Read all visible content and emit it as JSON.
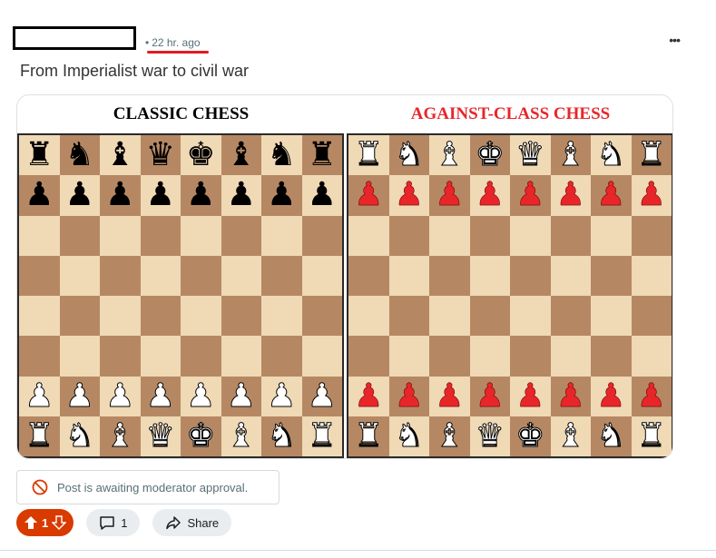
{
  "post": {
    "time_ago": "22 hr. ago",
    "title": "From Imperialist war to civil war"
  },
  "image": {
    "left_board": {
      "title": "CLASSIC CHESS",
      "title_color": "#000000",
      "ranks": [
        {
          "row": 0,
          "pieces": [
            "♜",
            "♞",
            "♝",
            "♛",
            "♚",
            "♝",
            "♞",
            "♜"
          ],
          "color": "black"
        },
        {
          "row": 1,
          "pieces": [
            "♟",
            "♟",
            "♟",
            "♟",
            "♟",
            "♟",
            "♟",
            "♟"
          ],
          "color": "black"
        },
        {
          "row": 6,
          "pieces": [
            "♟",
            "♟",
            "♟",
            "♟",
            "♟",
            "♟",
            "♟",
            "♟"
          ],
          "color": "white"
        },
        {
          "row": 7,
          "pieces": [
            "♜",
            "♞",
            "♝",
            "♛",
            "♚",
            "♝",
            "♞",
            "♜"
          ],
          "color": "white"
        }
      ]
    },
    "right_board": {
      "title": "AGAINST-CLASS CHESS",
      "title_color": "#e8262a",
      "ranks": [
        {
          "row": 0,
          "pieces": [
            "♜",
            "♞",
            "♝",
            "♚",
            "♛",
            "♝",
            "♞",
            "♜"
          ],
          "color": "white"
        },
        {
          "row": 1,
          "pieces": [
            "♟",
            "♟",
            "♟",
            "♟",
            "♟",
            "♟",
            "♟",
            "♟"
          ],
          "color": "red"
        },
        {
          "row": 6,
          "pieces": [
            "♟",
            "♟",
            "♟",
            "♟",
            "♟",
            "♟",
            "♟",
            "♟"
          ],
          "color": "red"
        },
        {
          "row": 7,
          "pieces": [
            "♜",
            "♞",
            "♝",
            "♛",
            "♚",
            "♝",
            "♞",
            "♜"
          ],
          "color": "white"
        }
      ]
    },
    "light_square_color": "#f0d9b5",
    "dark_square_color": "#b58863"
  },
  "notice": {
    "icon": "prohibited-icon",
    "text": "Post is awaiting moderator approval."
  },
  "actions": {
    "vote_count": "1",
    "comment_count": "1",
    "share_label": "Share",
    "vote_color": "#d93a00"
  }
}
